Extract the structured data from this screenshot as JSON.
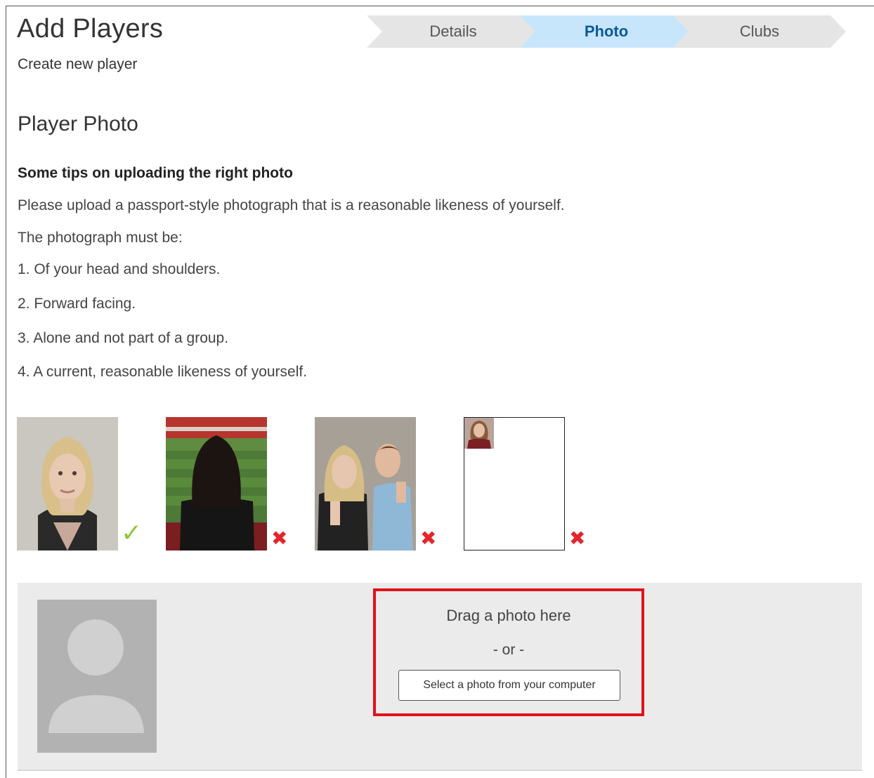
{
  "header": {
    "title": "Add Players",
    "subtitle": "Create new player"
  },
  "steps": [
    {
      "label": "Details",
      "active": false
    },
    {
      "label": "Photo",
      "active": true
    },
    {
      "label": "Clubs",
      "active": false
    }
  ],
  "section": {
    "title": "Player Photo",
    "tips_heading": "Some tips on uploading the right photo",
    "intro": "Please upload a passport-style photograph that is a reasonable likeness of yourself.",
    "must_be": "The photograph must be:",
    "rules": [
      "1. Of your head and shoulders.",
      "2. Forward facing.",
      "3. Alone and not part of a group.",
      "4. A current, reasonable likeness of yourself."
    ]
  },
  "examples": [
    {
      "verdict": "check-icon",
      "mark": "✓",
      "acceptable": true
    },
    {
      "verdict": "cross-icon",
      "mark": "✖",
      "acceptable": false
    },
    {
      "verdict": "cross-icon",
      "mark": "✖",
      "acceptable": false
    },
    {
      "verdict": "cross-icon",
      "mark": "✖",
      "acceptable": false
    }
  ],
  "upload": {
    "drag_text": "Drag a photo here",
    "or_text": "- or -",
    "select_button": "Select a photo from your computer"
  },
  "colors": {
    "active_step_bg": "#c8e6fb",
    "active_step_text": "#0b5a97",
    "inactive_step_bg": "#e5e5e5",
    "ok_mark": "#8dc63f",
    "bad_mark": "#e3262c",
    "drop_zone_border": "#e0131b",
    "panel_bg": "#ebebeb"
  }
}
